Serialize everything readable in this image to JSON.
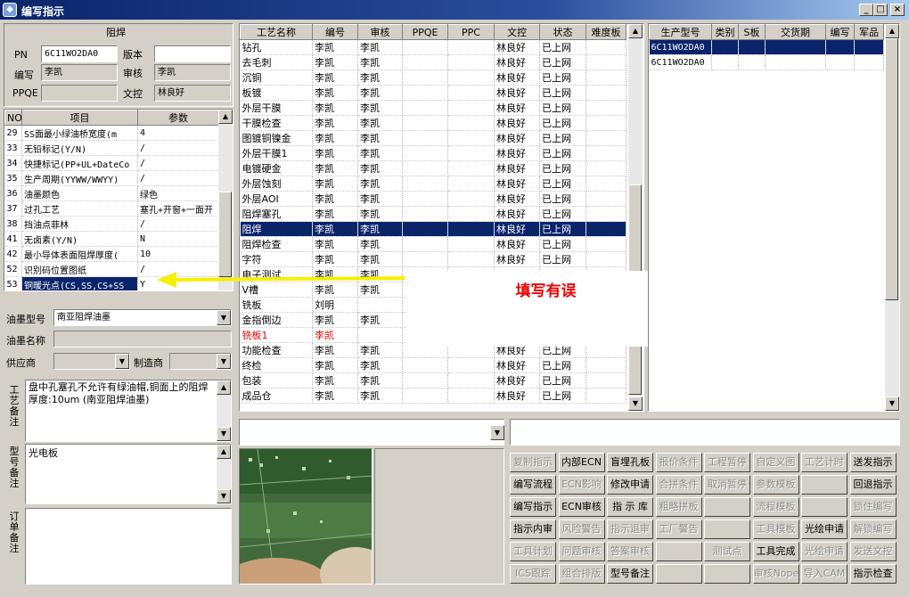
{
  "window": {
    "title": "编写指示",
    "min": "_",
    "max": "□",
    "close": "×"
  },
  "left": {
    "group_title": "阻焊",
    "pn_label": "PN",
    "pn_value": "6C11WO2DA0",
    "version_label": "版本",
    "version_value": "",
    "writer_label": "编写",
    "writer_value": "李凯",
    "reviewer_label": "审核",
    "reviewer_value": "李凯",
    "ppqe_label": "PPQE",
    "ppqe_value": "",
    "wenkong_label": "文控",
    "wenkong_value": "林良好",
    "param_headers": [
      "NO",
      "项目",
      "参数"
    ],
    "params": [
      {
        "no": "29",
        "item": "SS面最小绿油桥宽度(m",
        "val": "4"
      },
      {
        "no": "33",
        "item": "无铅标记(Y/N)",
        "val": "/"
      },
      {
        "no": "34",
        "item": "快捷标记(PP+UL+DateCo",
        "val": "/"
      },
      {
        "no": "35",
        "item": "生产周期(YYWW/WWYY)",
        "val": "/"
      },
      {
        "no": "36",
        "item": "油墨颜色",
        "val": "绿色"
      },
      {
        "no": "37",
        "item": "过孔工艺",
        "val": "塞孔+开窗+一面开"
      },
      {
        "no": "38",
        "item": "挡油点菲林",
        "val": "/"
      },
      {
        "no": "41",
        "item": "无卤素(Y/N)",
        "val": "N"
      },
      {
        "no": "42",
        "item": "最小导体表面阻焊厚度(",
        "val": "10"
      },
      {
        "no": "52",
        "item": "识别码位置图纸",
        "val": "/"
      },
      {
        "no": "53",
        "item": "铜暖光点(CS,SS,CS+SS",
        "val": "Y"
      }
    ],
    "ink_type_label": "油墨型号",
    "ink_type_value": "南亚阻焊油墨",
    "ink_name_label": "油墨名称",
    "ink_name_value": "",
    "supplier_label": "供应商",
    "supplier_value": "",
    "maker_label": "制造商",
    "maker_value": "",
    "process_note_label": "工艺备注",
    "process_note": "盘中孔塞孔不允许有绿油帽,铜面上的阻焊厚度:10um (南亚阻焊油墨)",
    "model_note_label": "型号备注",
    "model_note": "光电板",
    "order_note_label": "订单备注",
    "order_note": ""
  },
  "process": {
    "headers": [
      "工艺名称",
      "编号",
      "审核",
      "PPQE",
      "PPC",
      "文控",
      "状态",
      "难度板"
    ],
    "rows": [
      {
        "name": "钻孔",
        "code": "李凯",
        "review": "李凯",
        "ppqe": "",
        "ppc": "",
        "wk": "林良好",
        "status": "已上网",
        "diff": ""
      },
      {
        "name": "去毛刺",
        "code": "李凯",
        "review": "李凯",
        "ppqe": "",
        "ppc": "",
        "wk": "林良好",
        "status": "已上网",
        "diff": ""
      },
      {
        "name": "沉铜",
        "code": "李凯",
        "review": "李凯",
        "ppqe": "",
        "ppc": "",
        "wk": "林良好",
        "status": "已上网",
        "diff": ""
      },
      {
        "name": "板镀",
        "code": "李凯",
        "review": "李凯",
        "ppqe": "",
        "ppc": "",
        "wk": "林良好",
        "status": "已上网",
        "diff": ""
      },
      {
        "name": "外层干膜",
        "code": "李凯",
        "review": "李凯",
        "ppqe": "",
        "ppc": "",
        "wk": "林良好",
        "status": "已上网",
        "diff": ""
      },
      {
        "name": "干膜检查",
        "code": "李凯",
        "review": "李凯",
        "ppqe": "",
        "ppc": "",
        "wk": "林良好",
        "status": "已上网",
        "diff": ""
      },
      {
        "name": "图镀铜镍金",
        "code": "李凯",
        "review": "李凯",
        "ppqe": "",
        "ppc": "",
        "wk": "林良好",
        "status": "已上网",
        "diff": ""
      },
      {
        "name": "外层干膜1",
        "code": "李凯",
        "review": "李凯",
        "ppqe": "",
        "ppc": "",
        "wk": "林良好",
        "status": "已上网",
        "diff": ""
      },
      {
        "name": "电镀硬金",
        "code": "李凯",
        "review": "李凯",
        "ppqe": "",
        "ppc": "",
        "wk": "林良好",
        "status": "已上网",
        "diff": ""
      },
      {
        "name": "外层蚀刻",
        "code": "李凯",
        "review": "李凯",
        "ppqe": "",
        "ppc": "",
        "wk": "林良好",
        "status": "已上网",
        "diff": ""
      },
      {
        "name": "外层AOI",
        "code": "李凯",
        "review": "李凯",
        "ppqe": "",
        "ppc": "",
        "wk": "林良好",
        "status": "已上网",
        "diff": ""
      },
      {
        "name": "阻焊塞孔",
        "code": "李凯",
        "review": "李凯",
        "ppqe": "",
        "ppc": "",
        "wk": "林良好",
        "status": "已上网",
        "diff": ""
      },
      {
        "name": "阻焊",
        "code": "李凯",
        "review": "李凯",
        "ppqe": "",
        "ppc": "",
        "wk": "林良好",
        "status": "已上网",
        "diff": "",
        "selected": true
      },
      {
        "name": "阻焊检查",
        "code": "李凯",
        "review": "李凯",
        "ppqe": "",
        "ppc": "",
        "wk": "林良好",
        "status": "已上网",
        "diff": ""
      },
      {
        "name": "字符",
        "code": "李凯",
        "review": "李凯",
        "ppqe": "",
        "ppc": "",
        "wk": "林良好",
        "status": "已上网",
        "diff": ""
      },
      {
        "name": "电子测试",
        "code": "李凯",
        "review": "李凯",
        "ppqe": "",
        "ppc": "",
        "wk": "",
        "status": "",
        "diff": ""
      },
      {
        "name": "V槽",
        "code": "李凯",
        "review": "李凯",
        "ppqe": "",
        "ppc": "",
        "wk": "",
        "status": "",
        "diff": ""
      },
      {
        "name": "铣板",
        "code": "刘明",
        "review": "",
        "ppqe": "",
        "ppc": "",
        "wk": "",
        "status": "",
        "diff": ""
      },
      {
        "name": "金指倒边",
        "code": "李凯",
        "review": "李凯",
        "ppqe": "",
        "ppc": "",
        "wk": "",
        "status": "",
        "diff": ""
      },
      {
        "name": "铣板1",
        "code": "李凯",
        "review": "",
        "ppqe": "",
        "ppc": "",
        "wk": "",
        "status": "",
        "diff": "",
        "red": true
      },
      {
        "name": "功能检查",
        "code": "李凯",
        "review": "李凯",
        "ppqe": "",
        "ppc": "",
        "wk": "林良好",
        "status": "已上网",
        "diff": ""
      },
      {
        "name": "终检",
        "code": "李凯",
        "review": "李凯",
        "ppqe": "",
        "ppc": "",
        "wk": "林良好",
        "status": "已上网",
        "diff": ""
      },
      {
        "name": "包装",
        "code": "李凯",
        "review": "李凯",
        "ppqe": "",
        "ppc": "",
        "wk": "林良好",
        "status": "已上网",
        "diff": ""
      },
      {
        "name": "成品仓",
        "code": "李凯",
        "review": "李凯",
        "ppqe": "",
        "ppc": "",
        "wk": "林良好",
        "status": "已上网",
        "diff": ""
      }
    ]
  },
  "products": {
    "headers": [
      "生产型号",
      "类别",
      "S板",
      "交货期",
      "编写",
      "军品"
    ],
    "rows": [
      {
        "model": "6C11WO2DA0",
        "selected": true
      },
      {
        "model": "6C11WO2DA0",
        "selected": false
      }
    ]
  },
  "annotation": {
    "text": "填写有误"
  },
  "buttons": [
    {
      "label": "复制指示",
      "enabled": false
    },
    {
      "label": "内部ECN",
      "enabled": true
    },
    {
      "label": "盲埋孔板",
      "enabled": true
    },
    {
      "label": "报价条件",
      "enabled": false
    },
    {
      "label": "工程暂停",
      "enabled": false
    },
    {
      "label": "自定义图",
      "enabled": false
    },
    {
      "label": "工艺计时",
      "enabled": false
    },
    {
      "label": "送发指示",
      "enabled": true
    },
    {
      "label": "编写流程",
      "enabled": true
    },
    {
      "label": "ECN影响",
      "enabled": false
    },
    {
      "label": "修改申请",
      "enabled": true
    },
    {
      "label": "合拼条件",
      "enabled": false
    },
    {
      "label": "取消暂停",
      "enabled": false
    },
    {
      "label": "参数模板",
      "enabled": false
    },
    {
      "label": "",
      "enabled": false
    },
    {
      "label": "回退指示",
      "enabled": true
    },
    {
      "label": "编写指示",
      "enabled": true
    },
    {
      "label": "ECN审核",
      "enabled": true
    },
    {
      "label": "指 示 库",
      "enabled": true
    },
    {
      "label": "粗略拼板",
      "enabled": false
    },
    {
      "label": "",
      "enabled": false
    },
    {
      "label": "流程模板",
      "enabled": false
    },
    {
      "label": "",
      "enabled": false
    },
    {
      "label": "锁住编写",
      "enabled": false
    },
    {
      "label": "指示内审",
      "enabled": true
    },
    {
      "label": "风险警告",
      "enabled": false
    },
    {
      "label": "指示退审",
      "enabled": false
    },
    {
      "label": "工厂警告",
      "enabled": false
    },
    {
      "label": "",
      "enabled": false
    },
    {
      "label": "工具模板",
      "enabled": false
    },
    {
      "label": "光绘申请",
      "enabled": true
    },
    {
      "label": "解锁编写",
      "enabled": false
    },
    {
      "label": "工具计划",
      "enabled": false
    },
    {
      "label": "问题审核",
      "enabled": false
    },
    {
      "label": "答案审核",
      "enabled": false
    },
    {
      "label": "",
      "enabled": false
    },
    {
      "label": "测试点",
      "enabled": false
    },
    {
      "label": "工具完成",
      "enabled": true
    },
    {
      "label": "光绘申请",
      "enabled": false
    },
    {
      "label": "发送文控",
      "enabled": false
    },
    {
      "label": "ICS跟踪",
      "enabled": false
    },
    {
      "label": "组合排版",
      "enabled": false
    },
    {
      "label": "型号备注",
      "enabled": true
    },
    {
      "label": "",
      "enabled": false
    },
    {
      "label": "",
      "enabled": false
    },
    {
      "label": "审核Nope",
      "enabled": false
    },
    {
      "label": "导入CAM",
      "enabled": false
    },
    {
      "label": "指示检查",
      "enabled": true
    }
  ]
}
